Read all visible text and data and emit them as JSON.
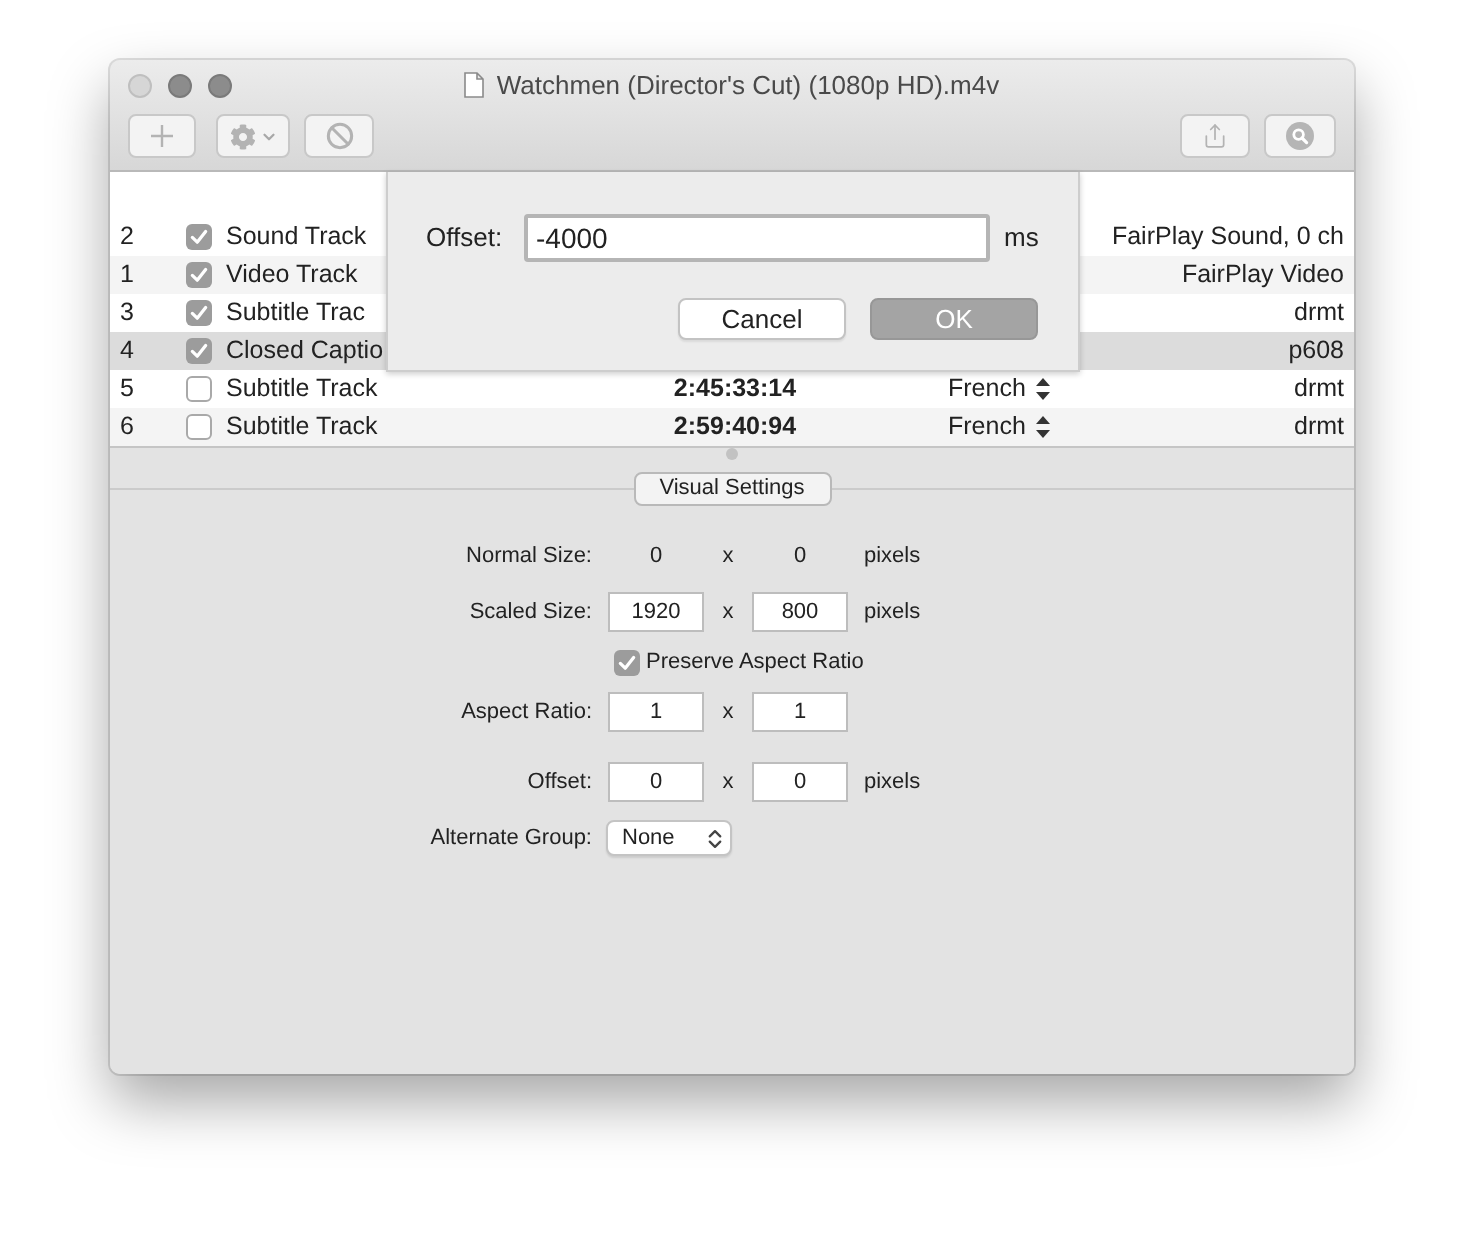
{
  "window": {
    "title": "Watchmen (Director's Cut) (1080p HD).m4v",
    "controls": [
      {
        "disabled": true
      },
      {
        "disabled": false
      },
      {
        "disabled": false
      }
    ]
  },
  "tracks": [
    {
      "number": "2",
      "checked": true,
      "name": "Sound Track",
      "format": "FairPlay Sound, 0 ch",
      "selected": false
    },
    {
      "number": "1",
      "checked": true,
      "name": "Video Track",
      "format": "FairPlay Video",
      "selected": false
    },
    {
      "number": "3",
      "checked": true,
      "name": "Subtitle Trac",
      "format": "drmt",
      "selected": false
    },
    {
      "number": "4",
      "checked": true,
      "name": "Closed Captio",
      "format": "p608",
      "selected": true
    },
    {
      "number": "5",
      "checked": false,
      "name": "Subtitle Track",
      "duration": "2:45:33:14",
      "language": "French",
      "format": "drmt",
      "selected": false
    },
    {
      "number": "6",
      "checked": false,
      "name": "Subtitle Track",
      "duration": "2:59:40:94",
      "language": "French",
      "format": "drmt",
      "selected": false
    }
  ],
  "offset_sheet": {
    "label": "Offset:",
    "value": "-4000",
    "unit": "ms",
    "buttons": [
      {
        "label": "Cancel",
        "default": false
      },
      {
        "label": "OK",
        "default": true
      }
    ]
  },
  "visual_settings": {
    "tab": "Visual Settings",
    "groups": [
      {
        "rows": [
          {
            "kind": "static",
            "label": "Normal Size:",
            "values": [
              "0",
              "0"
            ],
            "separator": "x",
            "unit": "pixels"
          },
          {
            "kind": "fields",
            "label": "Scaled Size:",
            "values": [
              "1920",
              "800"
            ],
            "separator": "x",
            "unit": "pixels"
          },
          {
            "kind": "checkbox",
            "label": "Preserve Aspect Ratio",
            "checked": true
          },
          {
            "kind": "fields",
            "label": "Aspect Ratio:",
            "values": [
              "1",
              "1"
            ],
            "separator": "x"
          }
        ]
      },
      {
        "rows": [
          {
            "kind": "fields",
            "label": "Offset:",
            "values": [
              "0",
              "0"
            ],
            "separator": "x",
            "unit": "pixels"
          },
          {
            "kind": "popup",
            "label": "Alternate Group:",
            "value": "None"
          }
        ]
      }
    ]
  }
}
